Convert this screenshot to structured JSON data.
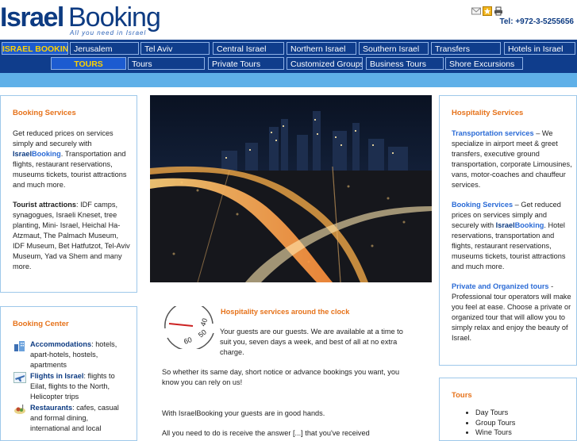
{
  "header": {
    "logo_israel": "Israel",
    "logo_booking": "Booking",
    "tagline": "All you need in Israel",
    "phone": "Tel: +972-3-5255656",
    "icons": [
      "email-icon",
      "favorite-icon",
      "print-icon"
    ]
  },
  "nav": {
    "row1": [
      "ISRAEL BOOKING",
      "Jerusalem",
      "Tel Aviv",
      "Central Israel",
      "Northern Israel",
      "Southern Israel",
      "Transfers",
      "Hotels in Israel"
    ],
    "row2": [
      "TOURS",
      "Tours",
      "Private Tours",
      "Customized Groups",
      "Business Tours",
      "Shore Excursions"
    ]
  },
  "left_box": {
    "title": "Booking Services",
    "p1_a": "Get reduced prices on services simply and securely with ",
    "brand_a": "Israel",
    "brand_b": "Booking",
    "p1_b": ". Transportation and flights, restaurant reservations, museums tickets, tourist attractions and much more.",
    "tourist_label": "Tourist attractions",
    "tourist_text": ":  IDF camps, synagogues, Israeli Kneset, tree planting, Mini- Israel, Heichal Ha-Atzmaut, The Palmach Museum, IDF Museum, Bet Hatfutzot, Tel-Aviv Museum, Yad va Shem and many more."
  },
  "booking_center": {
    "title": "Booking Center",
    "items": [
      {
        "label": "Accommodations",
        "text": ": hotels, apart-hotels, hostels, apartments"
      },
      {
        "label": "Flights in Israel",
        "text": ": flights to Eilat, flights to the North, Helicopter trips"
      },
      {
        "label": "Restaurants",
        "text": ": cafes, casual and formal dining, international and local"
      }
    ]
  },
  "center": {
    "heading": "Hospitality services around the clock",
    "p1": "Your guests are our guests. We are available at a time to suit you, seven days a week, and best of all at no extra charge.",
    "p2": "So whether its same day, short notice or advance bookings you want, you know you can rely on us!",
    "p3": "With IsraelBooking your guests are in good hands.",
    "p4": "All you need to do is receive the answer [...] that you've received"
  },
  "right_box": {
    "title": "Hospitality Services",
    "transport_label": "Transportation services",
    "transport_text": " – We specialize in airport meet & greet transfers, executive ground transportation, corporate Limousines, vans, motor-coaches and chauffeur services.",
    "booking_label": "Booking Services",
    "booking_text_a": " – Get reduced prices on services simply and securely with ",
    "brand_a": "Israel",
    "brand_b": "Booking",
    "booking_text_b": ". Hotel reservations, transportation and flights, restaurant reservations, museums tickets, tourist attractions and much more.",
    "private_label": "Private and Organized tours",
    "private_text": " - Professional tour operators will make you feel at ease. Choose a private or organized tour that will allow you to simply relax and enjoy the beauty of Israel."
  },
  "tours_box": {
    "title": "Tours",
    "items": [
      "Day Tours",
      "Group Tours",
      "Wine Tours"
    ]
  },
  "colors": {
    "navy": "#0f3d8c",
    "accent_orange": "#e6721a",
    "link_blue": "#2b6bd6",
    "strip": "#5fb0e8"
  }
}
